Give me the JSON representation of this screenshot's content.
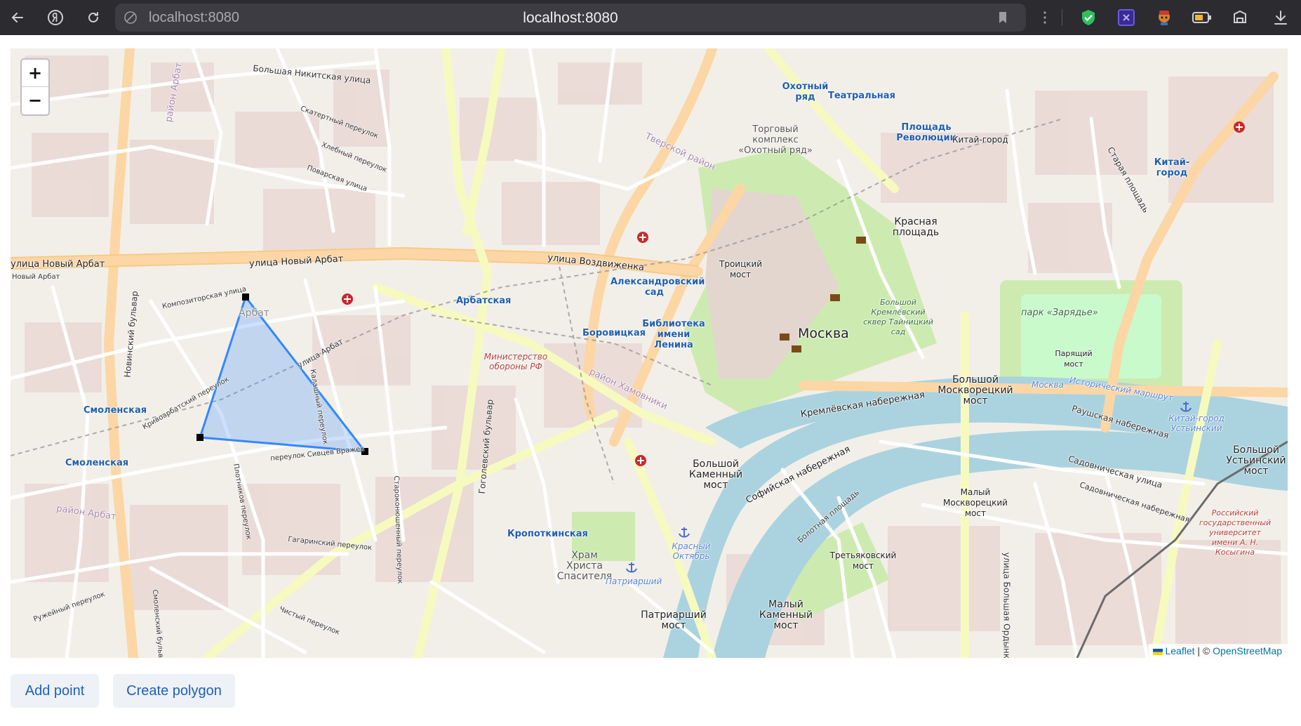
{
  "browser": {
    "url_left": "localhost:8080",
    "url_center": "localhost:8080",
    "nav_icons": [
      "back-arrow-icon",
      "yandex-icon",
      "reload-icon"
    ],
    "extension_icons": [
      "menu-dots-icon",
      "shield-check-icon",
      "extension-x-icon",
      "fox-icon",
      "battery-icon",
      "hat-icon",
      "download-icon"
    ]
  },
  "map": {
    "zoom_in": "+",
    "zoom_out": "−",
    "attribution": {
      "leaflet": "Leaflet",
      "separator": " | © ",
      "osm": "OpenStreetMap"
    },
    "labels": {
      "street_noviy_arbat_main": "улица Новый Арбат",
      "street_noviy_arbat_left": "улица Новый Арбат",
      "street_noviy_arbat_small": "Новый Арбат",
      "street_vozdvizhenka": "улица Воздвиженка",
      "street_bolshaya_nikitskaya": "Большая Никитская улица",
      "street_povarskaya": "Поварская улица",
      "street_skaterny": "Скатертный переулок",
      "street_khlebny": "Хлебный переулок",
      "street_kompozitorskaya": "Композиторская улица",
      "street_arbat": "улица Арбат",
      "street_krivoarbatsky": "Кривоарбатский переулок",
      "street_kalashny": "Калашный переулок",
      "street_sivtsev": "переулок Сивцев Вражек",
      "street_plotnikov": "Плотников переулок",
      "street_gagarinsky": "Гагаринский переулок",
      "street_chisty": "Чистый переулок",
      "street_ruzheyny": "Ружейный переулок",
      "street_starokonyushenny": "Староконюшенный переулок",
      "street_gogolevsky": "Гоголевский бульвар",
      "street_novinsky": "Новинский бульвар",
      "street_smolensky": "Смоленский бульвар",
      "street_kremlevskaya": "Кремлёвская набережная",
      "street_sofiyskaya": "Софийская набережная",
      "street_raushskaya": "Раушская набережная",
      "street_sadovnicheskaya": "Садовническая улица",
      "street_sadovnicheskaya_nab": "Садовническая набережная",
      "street_bolotnaya": "Болотная площадь",
      "street_staraya": "Старая площадь",
      "street_bolshaya_ordynka": "улица Большая Ордынка",
      "metro_arbatskaya": "Арбатская",
      "metro_smolenskaya_1": "Смоленская",
      "metro_smolenskaya_2": "Смоленская",
      "metro_borovitskaya": "Боровицкая",
      "metro_aleksandrovsky": "Александровский сад",
      "metro_biblioteka": "Библиотека имени Ленина",
      "metro_kropotkinskaya": "Кропоткинская",
      "metro_okhotny": "Охотный ряд",
      "metro_teatralnaya": "Театральная",
      "metro_revolyutsii": "Площадь Революции",
      "metro_kitay_gorod": "Китай-город",
      "place_kitay_gorod": "Китай-город",
      "place_krasnaya": "Красная площадь",
      "place_moskva": "Москва",
      "place_troitsky": "Троицкий мост",
      "place_bolshoy_moskvoretsky": "Большой Москворецкий мост",
      "place_bolshoy_kamenny": "Большой Каменный мост",
      "place_maly_moskvoretsky": "Малый Москворецкий мост",
      "place_maly_kamenny": "Малый Каменный мост",
      "place_patriarshy": "Патриарший мост",
      "place_paryashchy": "Парящий мост",
      "place_tretyakovsky": "Третьяковский мост",
      "place_bolshoy_ustinsky": "Большой Устьинский мост",
      "place_khram": "Храм Христа Спасителя",
      "place_torgovy": "Торговый комплекс «Охотный ряд»",
      "place_arbat_district": "Арбат",
      "poi_ministerstvo": "Министерство обороны РФ",
      "park_zaryadye": "парк «Зарядье»",
      "park_kremlin": "Большой Кремлёвский сквер Тайницкий сад",
      "district_arbat": "район Арбат",
      "district_tverskoy": "Тверской район",
      "district_arbat2": "район Арбат",
      "district_khamovniki": "район Хамовники",
      "water_moskva": "Москва",
      "water_route": "Исторический маршрут",
      "water_patriarshy": "Патриарший",
      "water_krasny": "Красный Октябрь",
      "water_kitay": "Китай-город Устьинский",
      "poi_univ": "Российский государственный университет имени А. Н. Косыгина"
    },
    "polygon_vertices": [
      {
        "name": "vertex-top"
      },
      {
        "name": "vertex-left"
      },
      {
        "name": "vertex-right"
      }
    ],
    "colors": {
      "polygon_stroke": "#3388ff",
      "polygon_fill": "#3388ff",
      "river": "#aad3df",
      "park": "#c8facc",
      "road_major": "#fcd6a4",
      "road_primary": "#f7fabf",
      "background": "#f2efe9"
    }
  },
  "buttons": {
    "add_point": "Add point",
    "create_polygon": "Create polygon"
  }
}
